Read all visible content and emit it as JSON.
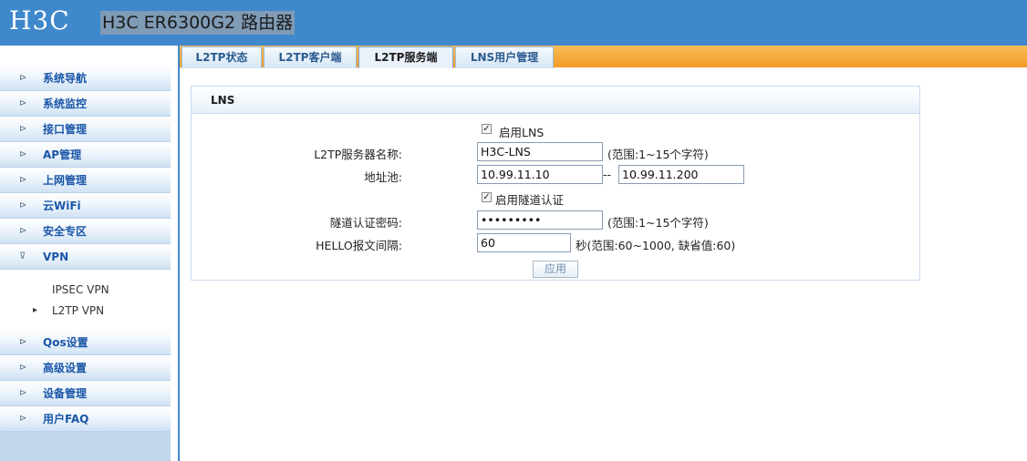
{
  "header": {
    "logo": "H3C",
    "product_title": "H3C ER6300G2 路由器"
  },
  "sidebar": {
    "items": [
      {
        "label": "系统导航"
      },
      {
        "label": "系统监控"
      },
      {
        "label": "接口管理"
      },
      {
        "label": "AP管理"
      },
      {
        "label": "上网管理"
      },
      {
        "label": "云WiFi"
      },
      {
        "label": "安全专区"
      },
      {
        "label": "VPN"
      },
      {
        "label": "Qos设置"
      },
      {
        "label": "高级设置"
      },
      {
        "label": "设备管理"
      },
      {
        "label": "用户FAQ"
      }
    ],
    "vpn_sub": [
      {
        "label": "IPSEC VPN"
      },
      {
        "label": "L2TP VPN"
      }
    ]
  },
  "tabs": [
    {
      "label": "L2TP状态"
    },
    {
      "label": "L2TP客户端"
    },
    {
      "label": "L2TP服务端"
    },
    {
      "label": "LNS用户管理"
    }
  ],
  "panel": {
    "title": "LNS",
    "enable_lns": {
      "label": "启用LNS",
      "checked": true
    },
    "server_name": {
      "label": "L2TP服务器名称:",
      "value": "H3C-LNS",
      "hint": "(范围:1~15个字符)"
    },
    "address_pool": {
      "label": "地址池:",
      "start": "10.99.11.10",
      "separator": "--",
      "end": "10.99.11.200"
    },
    "tunnel_auth": {
      "label": "启用隧道认证",
      "checked": true
    },
    "tunnel_password": {
      "label": "隧道认证密码:",
      "value": "•••••••••",
      "hint": "(范围:1~15个字符)"
    },
    "hello_interval": {
      "label": "HELLO报文间隔:",
      "value": "60",
      "hint": "秒(范围:60~1000, 缺省值:60)"
    },
    "apply_button": "应用"
  }
}
